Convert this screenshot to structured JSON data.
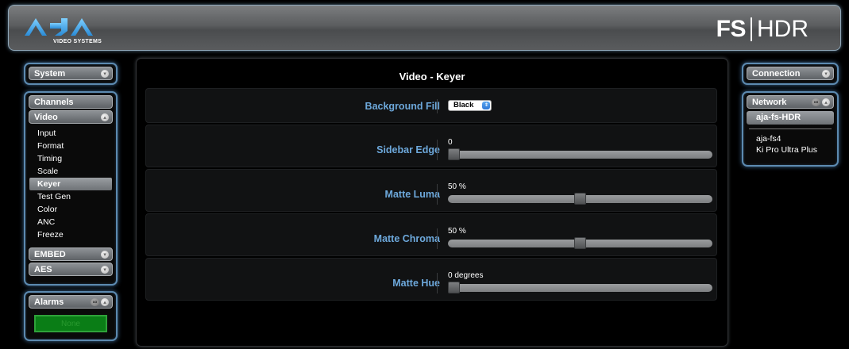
{
  "header": {
    "logo_text": "AJA",
    "logo_subtext": "VIDEO SYSTEMS",
    "product_bold": "FS",
    "product_light": "HDR"
  },
  "left_panel": {
    "system": {
      "label": "System"
    },
    "channels": {
      "label": "Channels"
    },
    "video": {
      "label": "Video",
      "items": [
        "Input",
        "Format",
        "Timing",
        "Scale",
        "Keyer",
        "Test Gen",
        "Color",
        "ANC",
        "Freeze"
      ],
      "active_item": "Keyer"
    },
    "embed": {
      "label": "EMBED"
    },
    "aes": {
      "label": "AES"
    },
    "alarms": {
      "label": "Alarms",
      "status": "None"
    }
  },
  "main": {
    "title": "Video - Keyer",
    "rows": [
      {
        "label": "Background Fill",
        "type": "select",
        "value": "Black"
      },
      {
        "label": "Sidebar Edge",
        "type": "slider",
        "value": "0",
        "fraction": 0.0
      },
      {
        "label": "Matte Luma",
        "type": "slider",
        "value": "50 %",
        "fraction": 0.5
      },
      {
        "label": "Matte Chroma",
        "type": "slider",
        "value": "50 %",
        "fraction": 0.5
      },
      {
        "label": "Matte Hue",
        "type": "slider",
        "value": "0 degrees",
        "fraction": 0.0
      }
    ]
  },
  "right_panel": {
    "connection": {
      "label": "Connection"
    },
    "network": {
      "label": "Network",
      "selected": "aja-fs-HDR",
      "devices": [
        "aja-fs4",
        "Ki Pro Ultra Plus"
      ]
    }
  },
  "colors": {
    "accent_blue": "#6da8db",
    "panel_border": "#5c8ab0",
    "alarm_green": "#0a7d16"
  }
}
